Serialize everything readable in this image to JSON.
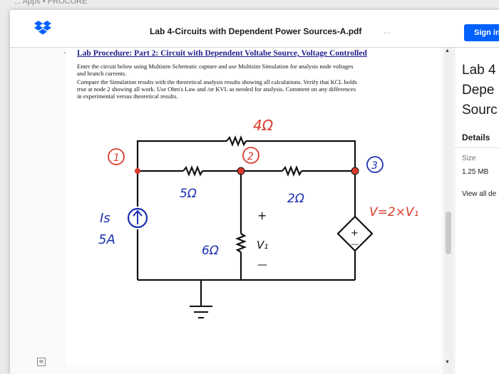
{
  "browser": {
    "top_strip_text": "... Apps ▪ PROCORE"
  },
  "header": {
    "title": "Lab 4-Circuits with Dependent Power Sources-A.pdf",
    "menu_dots": "...",
    "sign_in_label": "Sign in"
  },
  "document": {
    "heading": "Lab Procedure: Part 2:  Circuit with Dependent Voltabe Source, Voltage Controlled",
    "paragraph_lines": [
      "Enter the circuit below using Multisim Schematic capture and use Multisim Simulation for analysis node voltages",
      "and branch currents.",
      "Compare the Simulation results with the theoretical analysis results showing all calculations. Verify that KCL holds",
      "true at node 2 showing all work.  Use Ohm's Law and /or KVL as needed for analysis. Comment on any differences",
      "in experimental versus theoretical results."
    ],
    "circuit": {
      "top_resistor": "4Ω",
      "left_resistor": "5Ω",
      "right_resistor": "2Ω",
      "middle_resistor": "6Ω",
      "node1_label": "1",
      "node2_label": "2",
      "node3_label": "3",
      "current_source_label": "Is",
      "current_source_value": "5A",
      "v1_plus": "+",
      "v1_label": "V₁",
      "v1_minus": "—",
      "dep_source_label": "V=2×V₁",
      "dep_plus": "+",
      "dep_minus": "—"
    }
  },
  "sidebar": {
    "title_lines": [
      "Lab 4",
      "Depe",
      "Sourc"
    ],
    "details_label": "Details",
    "size_label": "Size",
    "size_value": "1.25 MB",
    "view_all_label": "View all de"
  },
  "colors": {
    "accent": "#0061fe",
    "heading": "#1f1f8c",
    "wire": "#111111",
    "node_red": "#d93a2b",
    "ink_red": "#d93a2b",
    "ink_blue": "#1c2fb0"
  }
}
